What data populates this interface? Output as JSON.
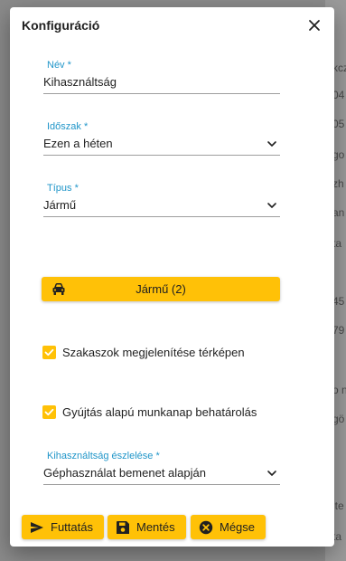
{
  "background": {
    "fragments": [
      "kcz",
      "04",
      "05",
      "go",
      "zh",
      "an",
      "ta",
      "45",
      "79",
      "o n",
      "gö",
      "ite",
      "ta"
    ]
  },
  "dialog": {
    "title": "Konfiguráció",
    "close_icon": "close-icon"
  },
  "fields": {
    "name": {
      "label": "Név *",
      "value": "Kihasználtság"
    },
    "period": {
      "label": "Időszak *",
      "value": "Ezen a héten"
    },
    "type": {
      "label": "Típus *",
      "value": "Jármű"
    },
    "detection": {
      "label": "Kihasználtság észlelése *",
      "value": "Géphasználat bemenet alapján"
    }
  },
  "vehicle_button": {
    "label": "Jármű (2)",
    "icon": "car-icon"
  },
  "checkboxes": {
    "show_sections": {
      "label": "Szakaszok megjelenítése térképen",
      "checked": true
    },
    "ignition_workday": {
      "label": "Gyújtás alapú munkanap behatárolás",
      "checked": true
    }
  },
  "footer": {
    "run_label": "Futtatás",
    "save_label": "Mentés",
    "cancel_label": "Mégse"
  },
  "colors": {
    "accent": "#ffc107",
    "label": "#2196c9",
    "text": "#212121",
    "overlay": "#8a8a8a"
  }
}
